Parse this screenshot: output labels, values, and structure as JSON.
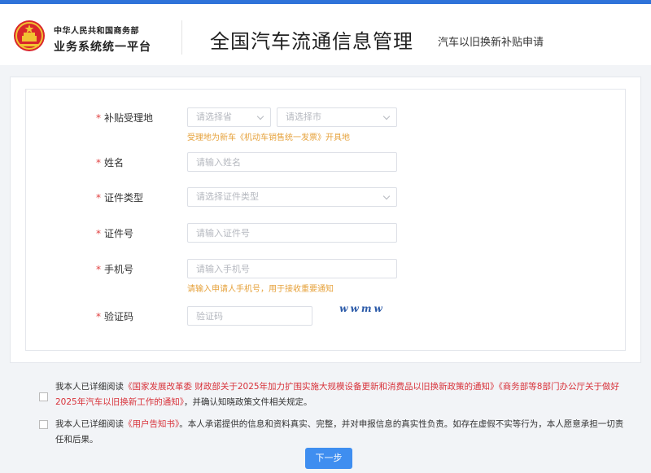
{
  "header": {
    "org_line1": "中华人民共和国商务部",
    "org_line2": "业务系统统一平台",
    "title": "全国汽车流通信息管理",
    "subtitle": "汽车以旧换新补贴申请"
  },
  "form": {
    "region": {
      "label": "补贴受理地",
      "province_placeholder": "请选择省",
      "city_placeholder": "请选择市",
      "hint": "受理地为新车《机动车销售统一发票》开具地"
    },
    "name": {
      "label": "姓名",
      "placeholder": "请输入姓名"
    },
    "id_type": {
      "label": "证件类型",
      "placeholder": "请选择证件类型"
    },
    "id_number": {
      "label": "证件号",
      "placeholder": "请输入证件号"
    },
    "phone": {
      "label": "手机号",
      "placeholder": "请输入手机号",
      "hint": "请输入申请人手机号，用于接收重要通知"
    },
    "captcha": {
      "label": "验证码",
      "placeholder": "验证码",
      "image_text": "wwmw"
    },
    "required_mark": "*"
  },
  "agreements": {
    "first": {
      "prefix": "我本人已详细阅读",
      "doc1": "《国家发展改革委 财政部关于2025年加力扩围实施大规模设备更新和消费品以旧换新政策的通知》",
      "doc2": "《商务部等8部门办公厅关于做好2025年汽车以旧换新工作的通知》",
      "suffix": "，并确认知晓政策文件相关规定。"
    },
    "second": {
      "prefix": "我本人已详细阅读",
      "doc": "《用户告知书》",
      "suffix": "。本人承诺提供的信息和资料真实、完整，并对申报信息的真实性负责。如存在虚假不实等行为，本人愿意承担一切责任和后果。"
    }
  },
  "buttons": {
    "next": "下一步"
  },
  "colors": {
    "primary": "#3f8ef0",
    "required": "#e04040",
    "hint": "#e6a23c",
    "link": "#d8323a"
  }
}
